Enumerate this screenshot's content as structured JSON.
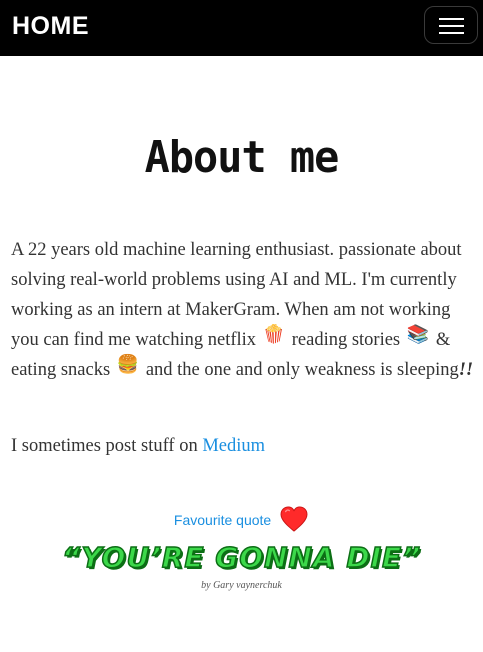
{
  "navbar": {
    "brand": "HOME",
    "toggle_icon": "hamburger-menu-icon"
  },
  "about": {
    "title": "About me",
    "bio_parts": {
      "p1": "A 22 years old machine learning enthusiast. passionate about solving real-world problems using AI and ML. I'm currently working as an intern at MakerGram. When am not working you can find me watching netflix",
      "emoji_popcorn": "🍿",
      "p2": "reading stories",
      "emoji_books": "📚",
      "p3": "& eating snacks",
      "emoji_burger": "🍔",
      "p4": "and the one and only weakness is sleeping",
      "p5": "!!"
    },
    "medium_prefix": "I sometimes post stuff on",
    "medium_link": "Medium"
  },
  "quote": {
    "label": "Favourite quote",
    "heart_icon": "heart-icon",
    "text": "“YOU’RE GONNA DIE”",
    "author": "by Gary vaynerchuk"
  },
  "colors": {
    "navbar_bg": "#000000",
    "link": "#1a8fe0",
    "quote_fill": "#3cd84a",
    "quote_outline": "#0c6e15",
    "heart": "#ff2a2a"
  }
}
